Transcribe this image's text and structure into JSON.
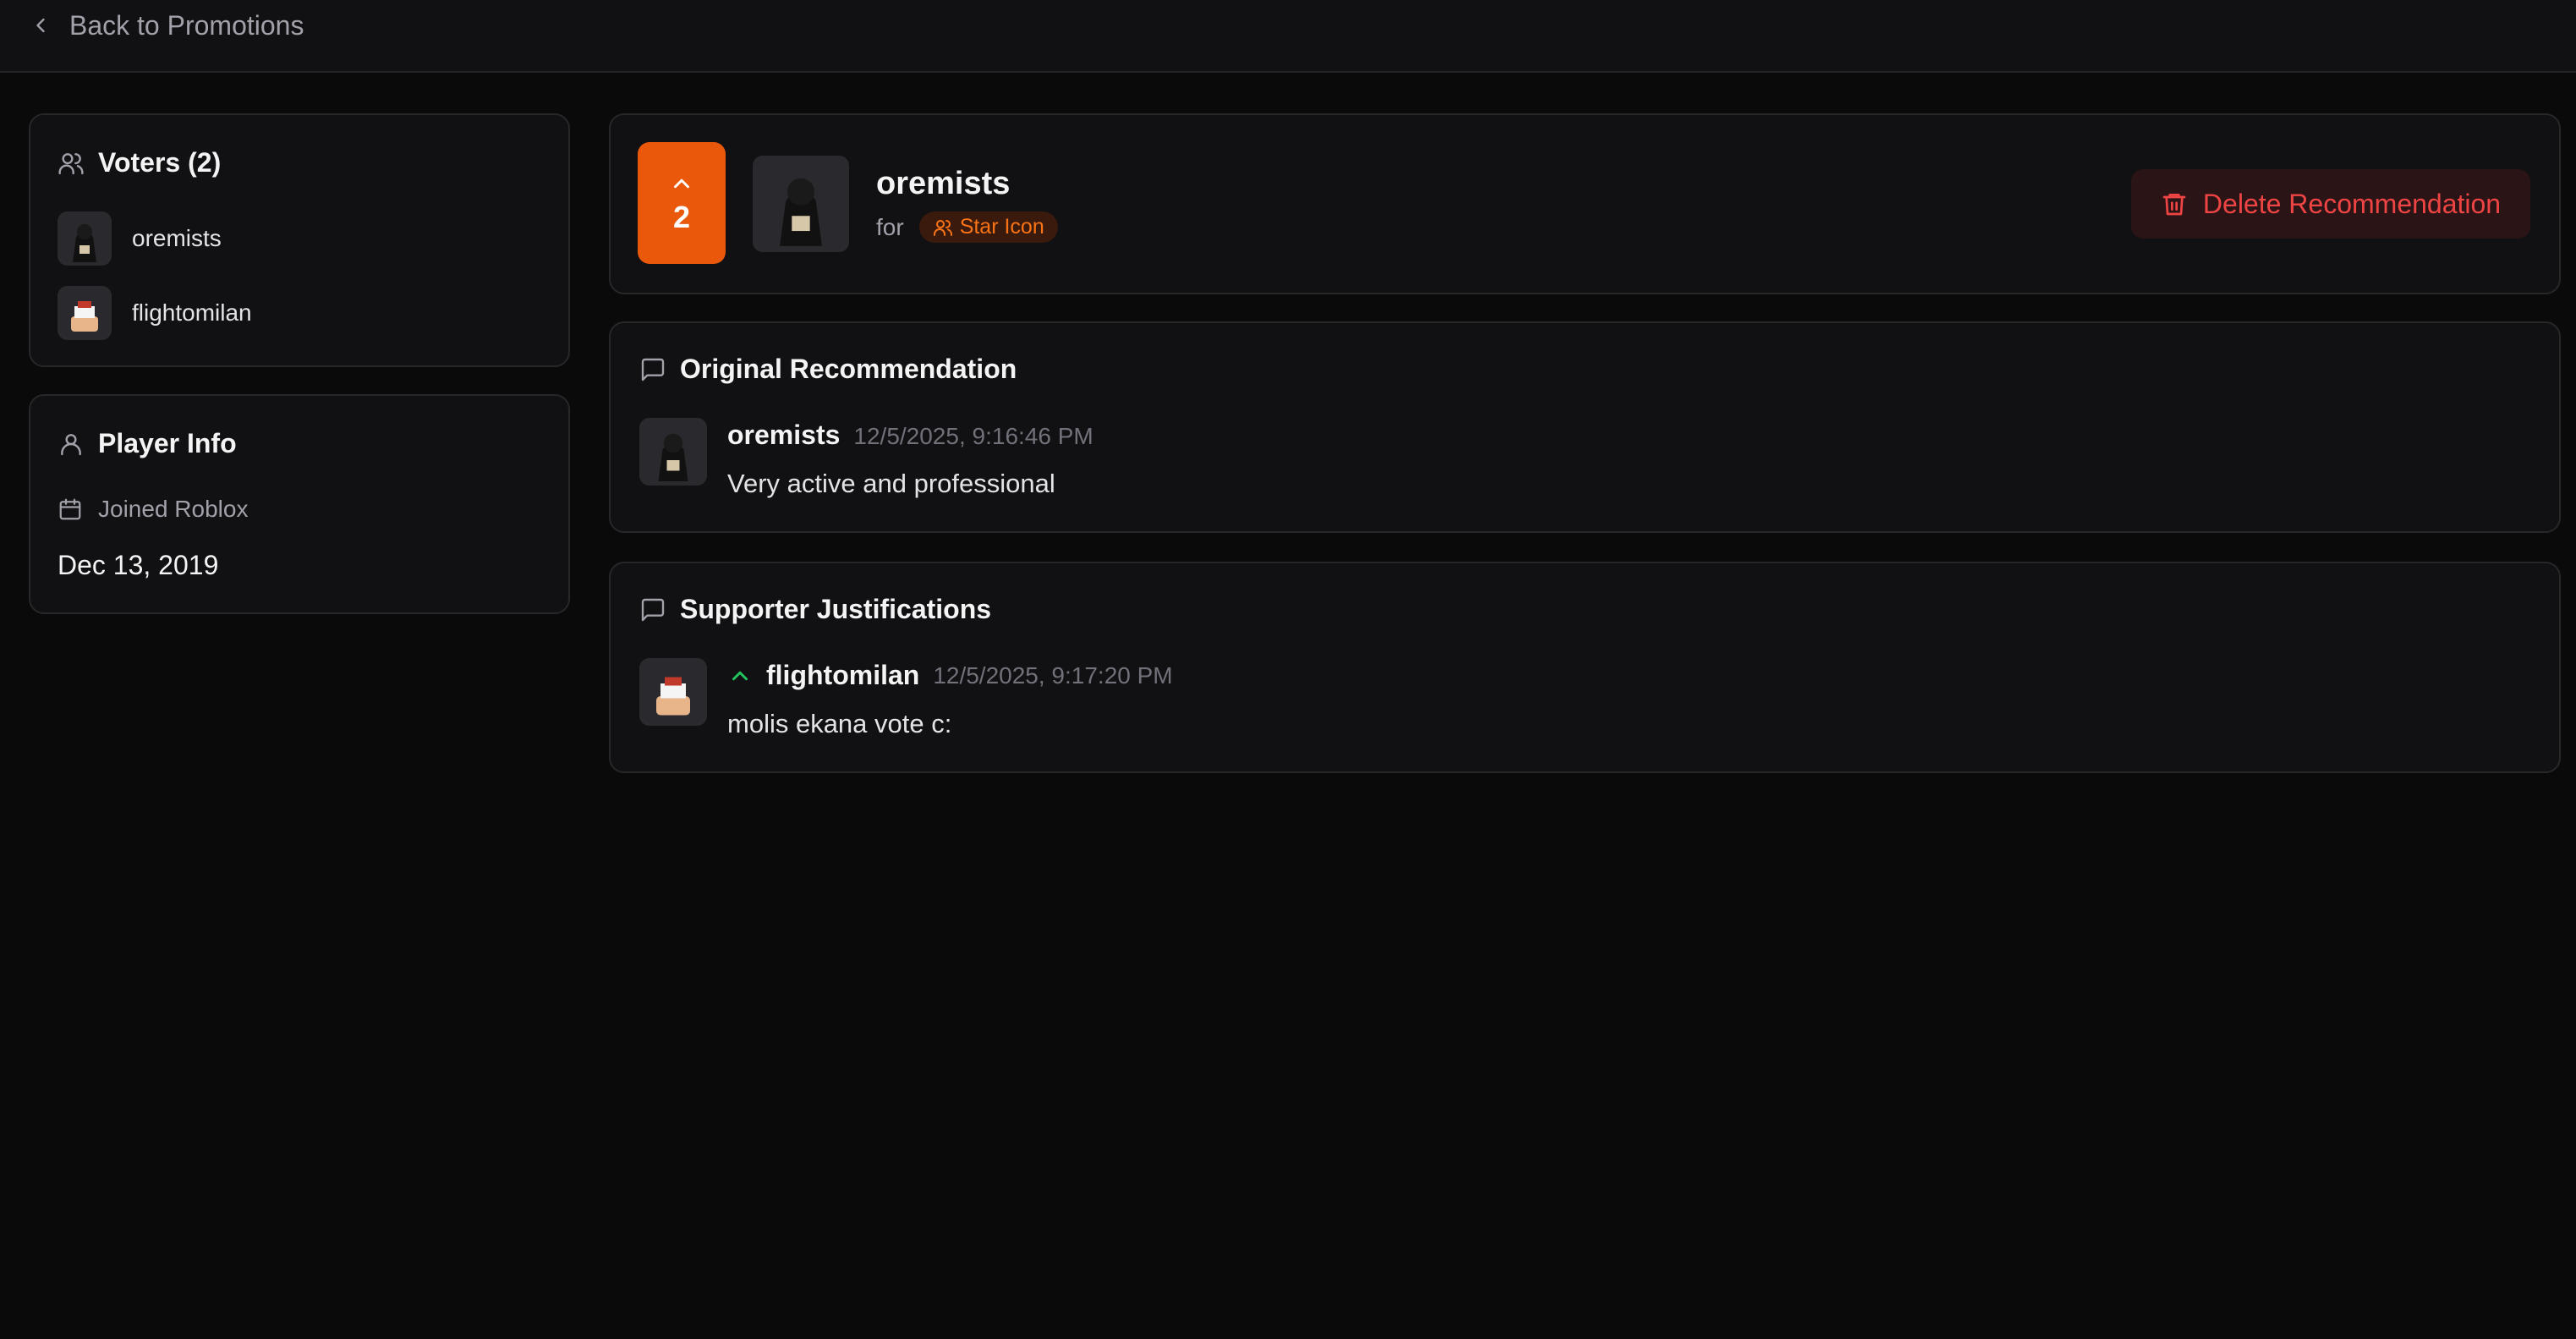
{
  "topbar": {
    "back_label": "Back to Promotions"
  },
  "voters": {
    "title": "Voters (2)",
    "items": [
      {
        "name": "oremists"
      },
      {
        "name": "flightomilan"
      }
    ]
  },
  "player_info": {
    "title": "Player Info",
    "joined_label": "Joined Roblox",
    "joined_date": "Dec 13, 2019"
  },
  "recommendation": {
    "vote_count": "2",
    "player_name": "oremists",
    "for_label": "for",
    "rank_badge": "Star Icon",
    "delete_label": "Delete Recommendation"
  },
  "original": {
    "title": "Original Recommendation",
    "author": "oremists",
    "timestamp": "12/5/2025, 9:16:46 PM",
    "text": "Very active and professional"
  },
  "supporters": {
    "title": "Supporter Justifications",
    "items": [
      {
        "author": "flightomilan",
        "timestamp": "12/5/2025, 9:17:20 PM",
        "text": "molis ekana vote c:"
      }
    ]
  },
  "colors": {
    "accent": "#ea580c",
    "danger": "#ef4444",
    "upvote": "#22c55e",
    "background": "#0a0a0a",
    "card": "#111113"
  },
  "icons": [
    "chevron-left-icon",
    "users-icon",
    "user-icon",
    "calendar-icon",
    "chevron-up-icon",
    "trash-icon",
    "message-square-icon"
  ]
}
